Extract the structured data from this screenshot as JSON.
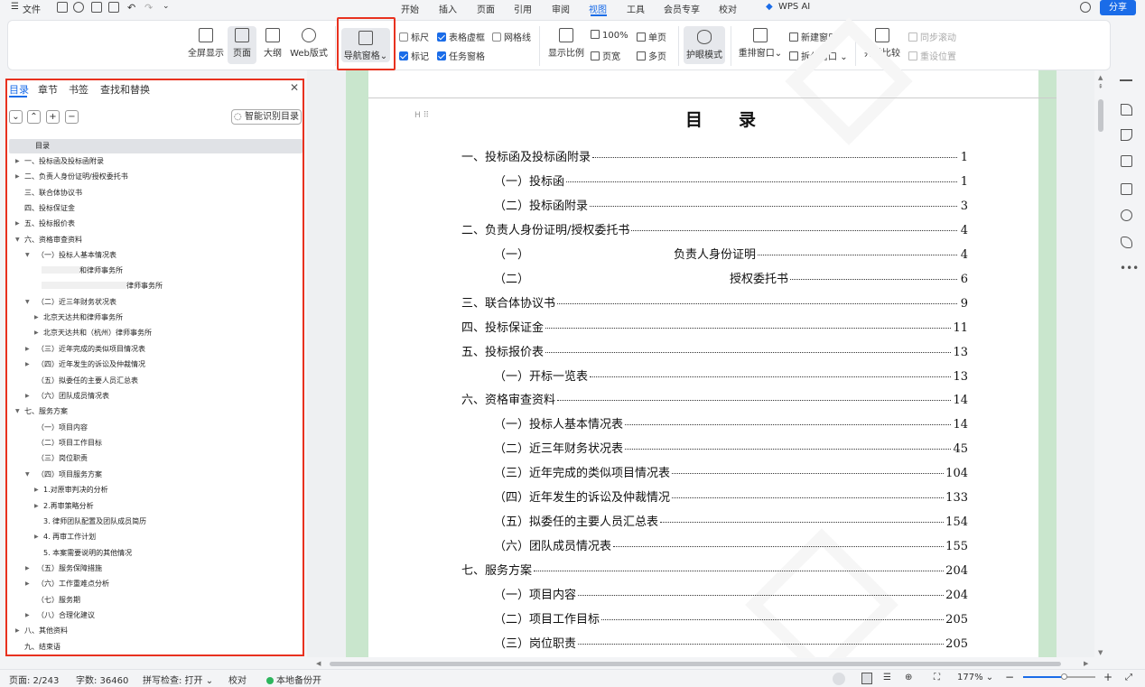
{
  "menu": {
    "file": "文件",
    "tabs": [
      "开始",
      "插入",
      "页面",
      "引用",
      "审阅",
      "视图",
      "工具",
      "会员专享",
      "校对"
    ],
    "wps_ai": "WPS AI",
    "share": "分享"
  },
  "ribbon": {
    "fullscreen": "全屏显示",
    "page": "页面",
    "outline": "大纲",
    "web": "Web版式",
    "nav_pane": "导航窗格",
    "ruler": "标尺",
    "marker": "标记",
    "table_grid": "表格虚框",
    "task_pane": "任务窗格",
    "gridlines": "网格线",
    "zoom_ratio": "显示比例",
    "hundred": "100%",
    "page_width": "页宽",
    "single_page": "单页",
    "multi_page": "多页",
    "eye_mode": "护眼模式",
    "arrange": "重排窗口",
    "new_window": "新建窗口",
    "split_window": "拆分窗口",
    "side_by_side": "并排比较",
    "sync_scroll": "同步滚动",
    "reset_position": "重设位置"
  },
  "nav": {
    "tabs": [
      "目录",
      "章节",
      "书签",
      "查找和替换"
    ],
    "smart": "智能识别目录",
    "items": [
      "目录",
      "一、投标函及投标函附录",
      "二、负责人身份证明/授权委托书",
      "三、联合体协议书",
      "四、投标保证金",
      "五、投标报价表",
      "六、资格审查资料",
      "（一）投标人基本情况表",
      "和律师事务所",
      "律师事务所",
      "（二）近三年财务状况表",
      "北京天达共和律师事务所",
      "北京天达共和（杭州）律师事务所",
      "（三）近年完成的类似项目情况表",
      "（四）近年发生的诉讼及仲裁情况",
      "（五）拟委任的主要人员汇总表",
      "（六）团队成员情况表",
      "七、服务方案",
      "（一）项目内容",
      "（二）项目工作目标",
      "（三）岗位职责",
      "（四）项目服务方案",
      "1.对原审判决的分析",
      "2.再审策略分析",
      "3. 律师团队配置及团队成员简历",
      "4. 再审工作计划",
      "5. 本案需要说明的其他情况",
      "（五）服务保障措施",
      "（六）工作重难点分析",
      "（七）服务期",
      "（八）合理化建议",
      "八、其他资料",
      "九、结束语"
    ]
  },
  "doc": {
    "heading_marker": "H",
    "title": "目录",
    "entries": [
      {
        "text": "一、投标函及投标函附录",
        "page": "1"
      },
      {
        "text": "（一）投标函",
        "page": "1"
      },
      {
        "text": "（二）投标函附录",
        "page": "3"
      },
      {
        "text": "二、负责人身份证明/授权委托书",
        "page": "4"
      },
      {
        "text": "（一）",
        "text2": "负责人身份证明",
        "page": "4"
      },
      {
        "text": "（二）",
        "text2": "授权委托书",
        "page": "6"
      },
      {
        "text": "三、联合体协议书",
        "page": "9"
      },
      {
        "text": "四、投标保证金",
        "page": "11"
      },
      {
        "text": "五、投标报价表",
        "page": "13"
      },
      {
        "text": "（一）开标一览表",
        "page": "13"
      },
      {
        "text": "六、资格审查资料",
        "page": "14"
      },
      {
        "text": "（一）投标人基本情况表",
        "page": "14"
      },
      {
        "text": "（二）近三年财务状况表",
        "page": "45"
      },
      {
        "text": "（三）近年完成的类似项目情况表",
        "page": "104"
      },
      {
        "text": "（四）近年发生的诉讼及仲裁情况",
        "page": "133"
      },
      {
        "text": "（五）拟委任的主要人员汇总表",
        "page": "154"
      },
      {
        "text": "（六）团队成员情况表",
        "page": "155"
      },
      {
        "text": "七、服务方案",
        "page": "204"
      },
      {
        "text": "（一）项目内容",
        "page": "204"
      },
      {
        "text": "（二）项目工作目标",
        "page": "205"
      },
      {
        "text": "（三）岗位职责",
        "page": "205"
      }
    ]
  },
  "status": {
    "page": "页面: 2/243",
    "words": "字数: 36460",
    "spell": "拼写检查: 打开",
    "proof": "校对",
    "backup": "本地备份开",
    "zoom": "177%"
  },
  "colors": {
    "accent": "#1a6ce8",
    "highlight": "#e8311f",
    "margin_green": "#c9e6cd"
  }
}
